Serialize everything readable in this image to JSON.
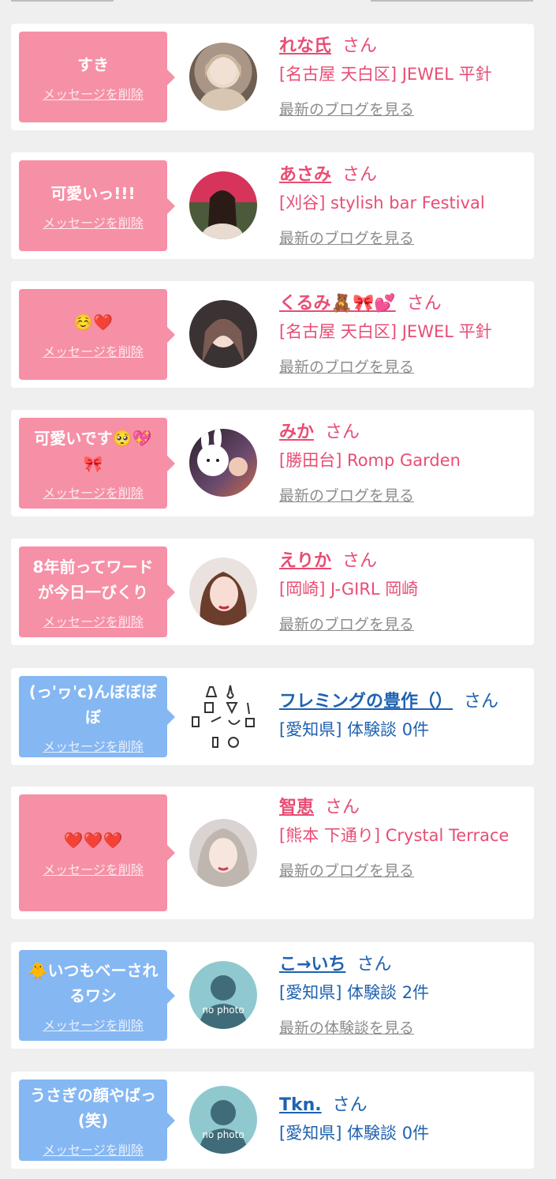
{
  "entries": [
    {
      "message": "すき",
      "delete_label": "メッセージを削除",
      "name": "れな氏",
      "honorific": "さん",
      "shop": "[名古屋 天白区] JEWEL 平針",
      "link": "最新のブログを見る",
      "avatar_icon": "user-photo-icon"
    },
    {
      "message": "可愛いっ!!!",
      "delete_label": "メッセージを削除",
      "name": "あさみ",
      "honorific": "さん",
      "shop": "[刈谷] stylish bar Festival",
      "link": "最新のブログを見る",
      "avatar_icon": "user-photo-icon"
    },
    {
      "message": "☺️❤️",
      "delete_label": "メッセージを削除",
      "name": "くるみ🧸🎀💕",
      "honorific": "さん",
      "shop": "[名古屋 天白区] JEWEL 平針",
      "link": "最新のブログを見る",
      "avatar_icon": "user-photo-icon"
    },
    {
      "message": "可愛いです🥺💖🎀",
      "delete_label": "メッセージを削除",
      "name": "みか",
      "honorific": "さん",
      "shop": "[勝田台] Romp Garden",
      "link": "最新のブログを見る",
      "avatar_icon": "user-photo-icon"
    },
    {
      "message": "8年前ってワードが今日一びくり",
      "delete_label": "メッセージを削除",
      "name": "えりか",
      "honorific": "さん",
      "shop": "[岡崎] J-GIRL 岡崎",
      "link": "最新のブログを見る",
      "avatar_icon": "user-photo-icon"
    },
    {
      "message": "(っ'ヮ'c)んぼぼぼぼ",
      "delete_label": "メッセージを削除",
      "name": "フレミングの豊作（）",
      "honorific": "さん",
      "shop": "[愛知県] 体験談 0件",
      "link": "",
      "avatar_icon": "lab-equipment-icon"
    },
    {
      "message": "❤️❤️❤️",
      "delete_label": "メッセージを削除",
      "name": "智恵",
      "honorific": "さん",
      "shop": "[熊本 下通り] Crystal Terrace",
      "link": "最新のブログを見る",
      "avatar_icon": "user-photo-icon"
    },
    {
      "message": "🐥いつもベーされるワシ",
      "delete_label": "メッセージを削除",
      "name": "こ→いち",
      "honorific": "さん",
      "shop": "[愛知県] 体験談 2件",
      "link": "最新の体験談を見る",
      "avatar_icon": "no-photo-icon",
      "avatar_text": "no photo"
    },
    {
      "message": "うさぎの顔やばっ(笑)",
      "delete_label": "メッセージを削除",
      "name": "Tkn.",
      "honorific": "さん",
      "shop": "[愛知県] 体験談 0件",
      "link": "",
      "avatar_icon": "no-photo-icon",
      "avatar_text": "no photo"
    }
  ],
  "colors": {
    "pink": "#f690a6",
    "blue": "#85b7f2",
    "name_pink": "#e84d74",
    "name_blue": "#1e62b0"
  }
}
